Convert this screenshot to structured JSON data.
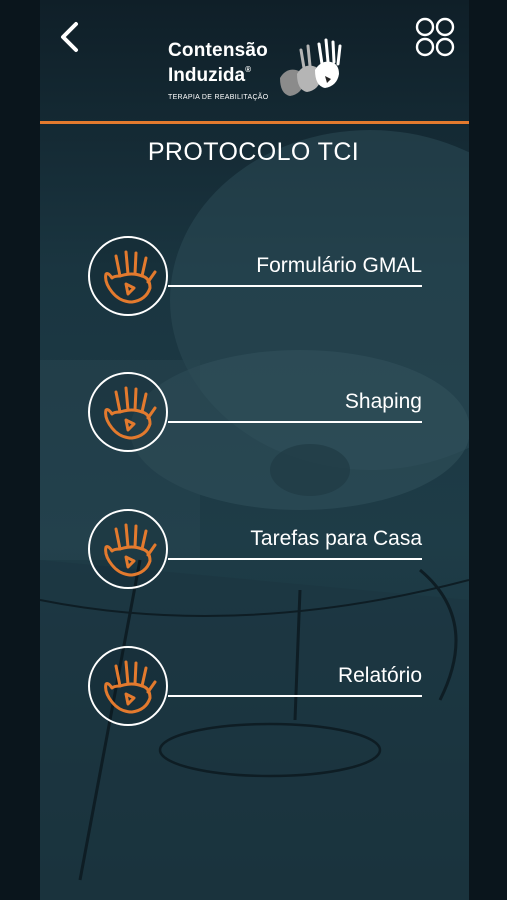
{
  "header": {
    "back_icon": "chevron-left-icon",
    "menu_icon": "four-circles-grid-icon",
    "logo": {
      "line1": "Contensão",
      "line2": "Induzida",
      "registered": "®",
      "subtitle": "TERAPIA DE REABILITAÇÃO"
    },
    "accent_color": "#e37a2e"
  },
  "page_title": "PROTOCOLO TCI",
  "menu": [
    {
      "label": "Formulário GMAL",
      "icon": "hand-icon"
    },
    {
      "label": "Shaping",
      "icon": "hand-icon"
    },
    {
      "label": "Tarefas para Casa",
      "icon": "hand-icon"
    },
    {
      "label": "Relatório",
      "icon": "hand-icon"
    }
  ]
}
